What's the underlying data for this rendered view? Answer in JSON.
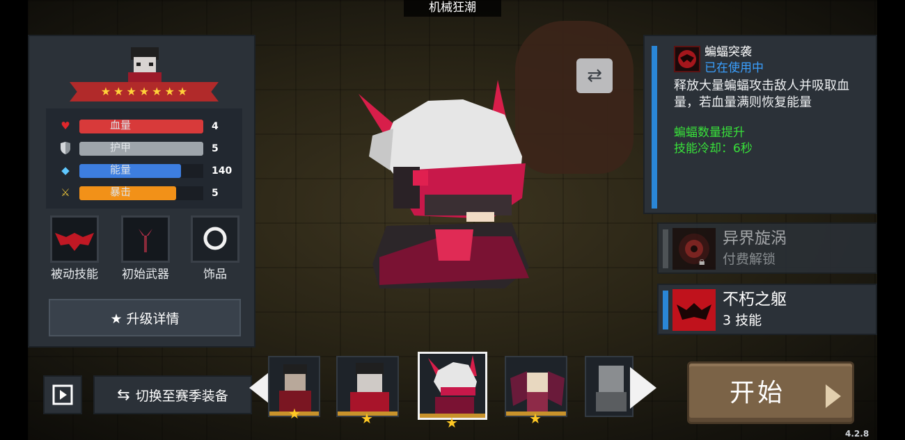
{
  "top_title": "机械狂潮",
  "character": {
    "star_count": 7
  },
  "stats": [
    {
      "label": "血量",
      "value": "4",
      "icon": "heart-icon",
      "color": "#d83a3a",
      "fill": 1.0
    },
    {
      "label": "护甲",
      "value": "5",
      "icon": "shield-icon",
      "color": "#9ea5ab",
      "fill": 1.0
    },
    {
      "label": "能量",
      "value": "140",
      "icon": "crystal-icon",
      "color": "#3d7ee0",
      "fill": 0.82
    },
    {
      "label": "暴击",
      "value": "5",
      "icon": "sword-icon",
      "color": "#f29118",
      "fill": 0.78
    }
  ],
  "equip": {
    "passive_label": "被动技能",
    "weapon_label": "初始武器",
    "accessory_label": "饰品"
  },
  "upgrade_button": "★ 升级详情",
  "switch_button": "切换至赛季装备",
  "skill": {
    "name": "蝙蝠突袭",
    "status": "已在使用中",
    "description": "释放大量蝙蝠攻击敌人并吸取血量，若血量满则恢复能量",
    "buff1": "蝙蝠数量提升",
    "buff2": "技能冷却：6秒",
    "accent": "#2a86d6",
    "buff_color": "#38e03a"
  },
  "alt_skills": [
    {
      "title": "异界旋涡",
      "sub": "付费解锁",
      "locked": true
    },
    {
      "title": "不朽之躯",
      "sub": "3 技能",
      "locked": false
    }
  ],
  "start_button": "开始",
  "version": "4.2.8"
}
